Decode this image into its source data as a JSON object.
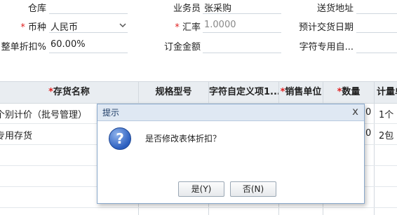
{
  "form": {
    "warehouse_label": "仓库",
    "salesperson_label": "业务员",
    "salesperson_value": "张采购",
    "delivery_address_label": "送货地址",
    "currency_label": "币种",
    "currency_value": "人民币",
    "exchange_rate_label": "汇率",
    "exchange_rate_value": "1.0000",
    "expected_delivery_label": "预计交货日期",
    "discount_label": "整单折扣%",
    "discount_value": "60.00%",
    "deposit_label": "订金金额",
    "custom_char_label": "字符专用自...",
    "required_mark": "*"
  },
  "table": {
    "columns": [
      {
        "label": "存货名称",
        "required": true
      },
      {
        "label": "规格型号",
        "required": false
      },
      {
        "label": "字符自定义项1...",
        "required": false
      },
      {
        "label": "销售单位",
        "required": true
      },
      {
        "label": "数量",
        "required": true
      },
      {
        "label": "计量单",
        "required": false
      }
    ],
    "rows": [
      {
        "name": "个别计价（批号管理）",
        "qty_tail": "0",
        "unit": "1个"
      },
      {
        "name": "专用存货",
        "qty_tail": "0",
        "unit": "2包"
      }
    ]
  },
  "dialog": {
    "title": "提示",
    "close": "x",
    "icon_glyph": "?",
    "message": "是否修改表体折扣？",
    "yes_label": "是(Y)",
    "no_label": "否(N)"
  }
}
